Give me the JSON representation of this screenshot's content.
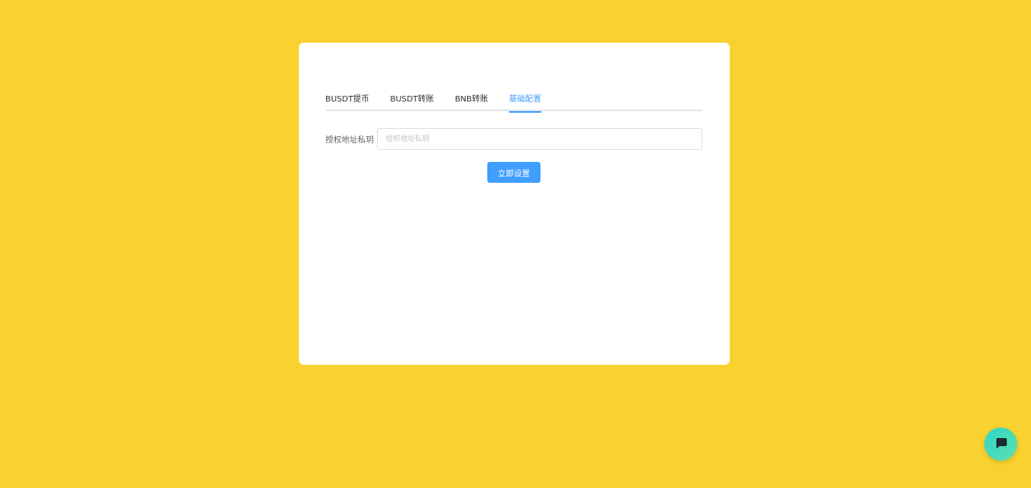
{
  "colors": {
    "background": "#f9d22f",
    "card": "#ffffff",
    "accent": "#409eff",
    "chat_button": "#3ddbc0"
  },
  "tabs": [
    {
      "label": "BUSDT提币",
      "active": false
    },
    {
      "label": "BUSDT转账",
      "active": false
    },
    {
      "label": "BNB转账",
      "active": false
    },
    {
      "label": "基础配置",
      "active": true
    }
  ],
  "form": {
    "field_label": "授权地址私玥",
    "field_placeholder": "授权地址私玥",
    "field_value": "",
    "submit_label": "立即设置"
  },
  "chat": {
    "icon": "chat-bubble-icon"
  }
}
